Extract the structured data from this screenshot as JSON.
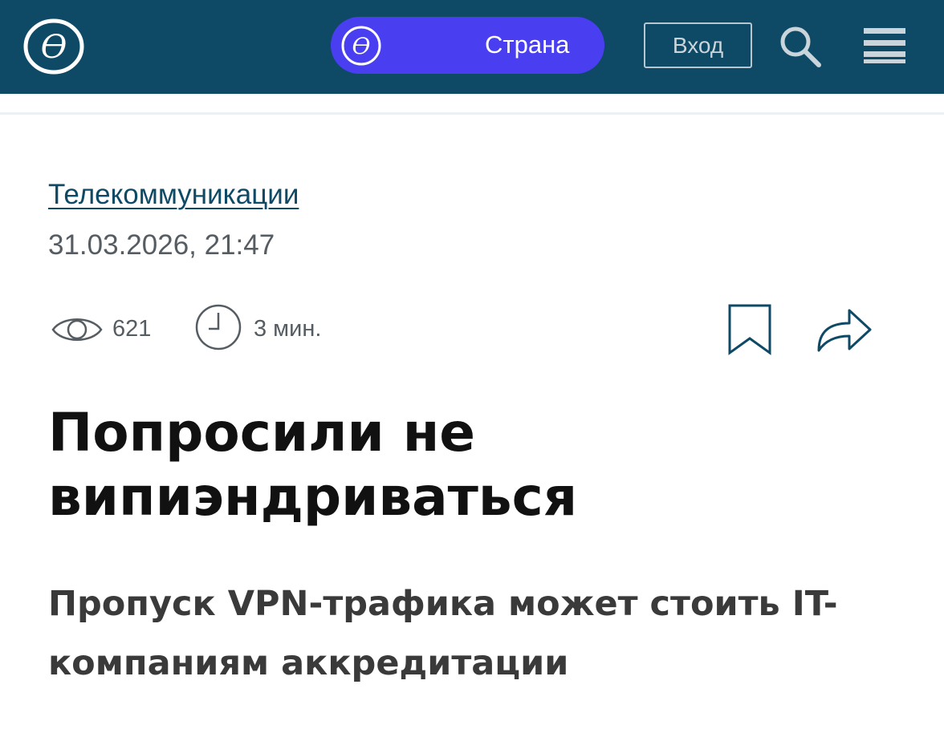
{
  "header": {
    "country_pill_label": "Страна",
    "login_label": "Вход"
  },
  "icons": {
    "logo": "publication-logo-icon",
    "pill_logo": "publication-logo-icon",
    "search": "search-icon",
    "menu": "hamburger-menu-icon",
    "views": "eye-icon",
    "read_time": "clock-icon",
    "bookmark": "bookmark-icon",
    "share": "share-arrow-icon"
  },
  "colors": {
    "header_bg": "#0e4a66",
    "pill_bg": "#4a3ff0",
    "category_link": "#0e4a66",
    "meta_text": "#555c62"
  },
  "article": {
    "category": "Телекоммуникации",
    "date": "31.03.2026, 21:47",
    "views": "621",
    "read_time": "3 мин.",
    "title": "Попросили не випиэндриваться",
    "subtitle": "Пропуск VPN-трафика может стоить IT-компаниям аккредитации"
  }
}
